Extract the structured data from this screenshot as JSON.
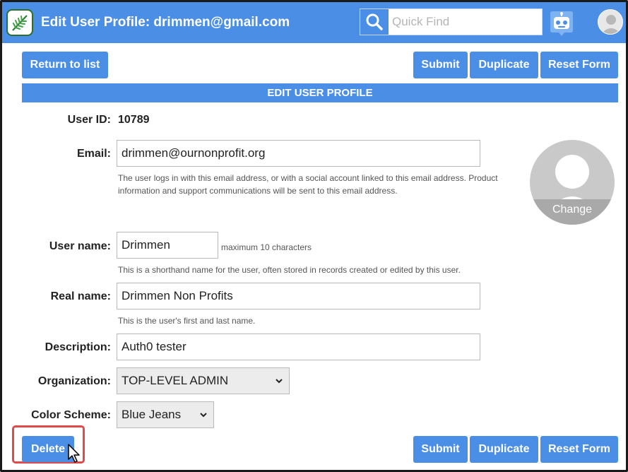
{
  "header": {
    "title": "Edit User Profile: drimmen@gmail.com",
    "search_placeholder": "Quick Find",
    "icons": [
      "fern-logo-icon",
      "search-icon",
      "robot-assistant-icon",
      "user-avatar-icon"
    ],
    "accent": "#4a8ee6"
  },
  "toolbar_top": {
    "return_label": "Return to list",
    "submit_label": "Submit",
    "duplicate_label": "Duplicate",
    "reset_label": "Reset Form"
  },
  "section": {
    "banner": "EDIT USER PROFILE"
  },
  "form": {
    "user_id": {
      "label": "User ID:",
      "value": "10789"
    },
    "email": {
      "label": "Email:",
      "value": "drimmen@ournonprofit.org",
      "help_line1": "The user logs in with this email address, or with a social account linked to this email address. Product",
      "help_line2": "information and support communications will be sent to this email address."
    },
    "photo": {
      "change_label": "Change"
    },
    "user_name": {
      "label": "User name:",
      "value": "Drimmen",
      "hint": "maximum 10 characters",
      "help": "This is a shorthand name for the user, often stored in records created or edited by this user."
    },
    "real_name": {
      "label": "Real name:",
      "value": "Drimmen Non Profits",
      "help": "This is the user's first and last name."
    },
    "description": {
      "label": "Description:",
      "value": "Auth0 tester"
    },
    "organization": {
      "label": "Organization:",
      "selected": "TOP-LEVEL ADMIN"
    },
    "color_scheme": {
      "label": "Color Scheme:",
      "selected": "Blue Jeans"
    }
  },
  "toolbar_bottom": {
    "delete_label": "Delete",
    "submit_label": "Submit",
    "duplicate_label": "Duplicate",
    "reset_label": "Reset Form"
  },
  "highlight_color": "#e04a4a"
}
